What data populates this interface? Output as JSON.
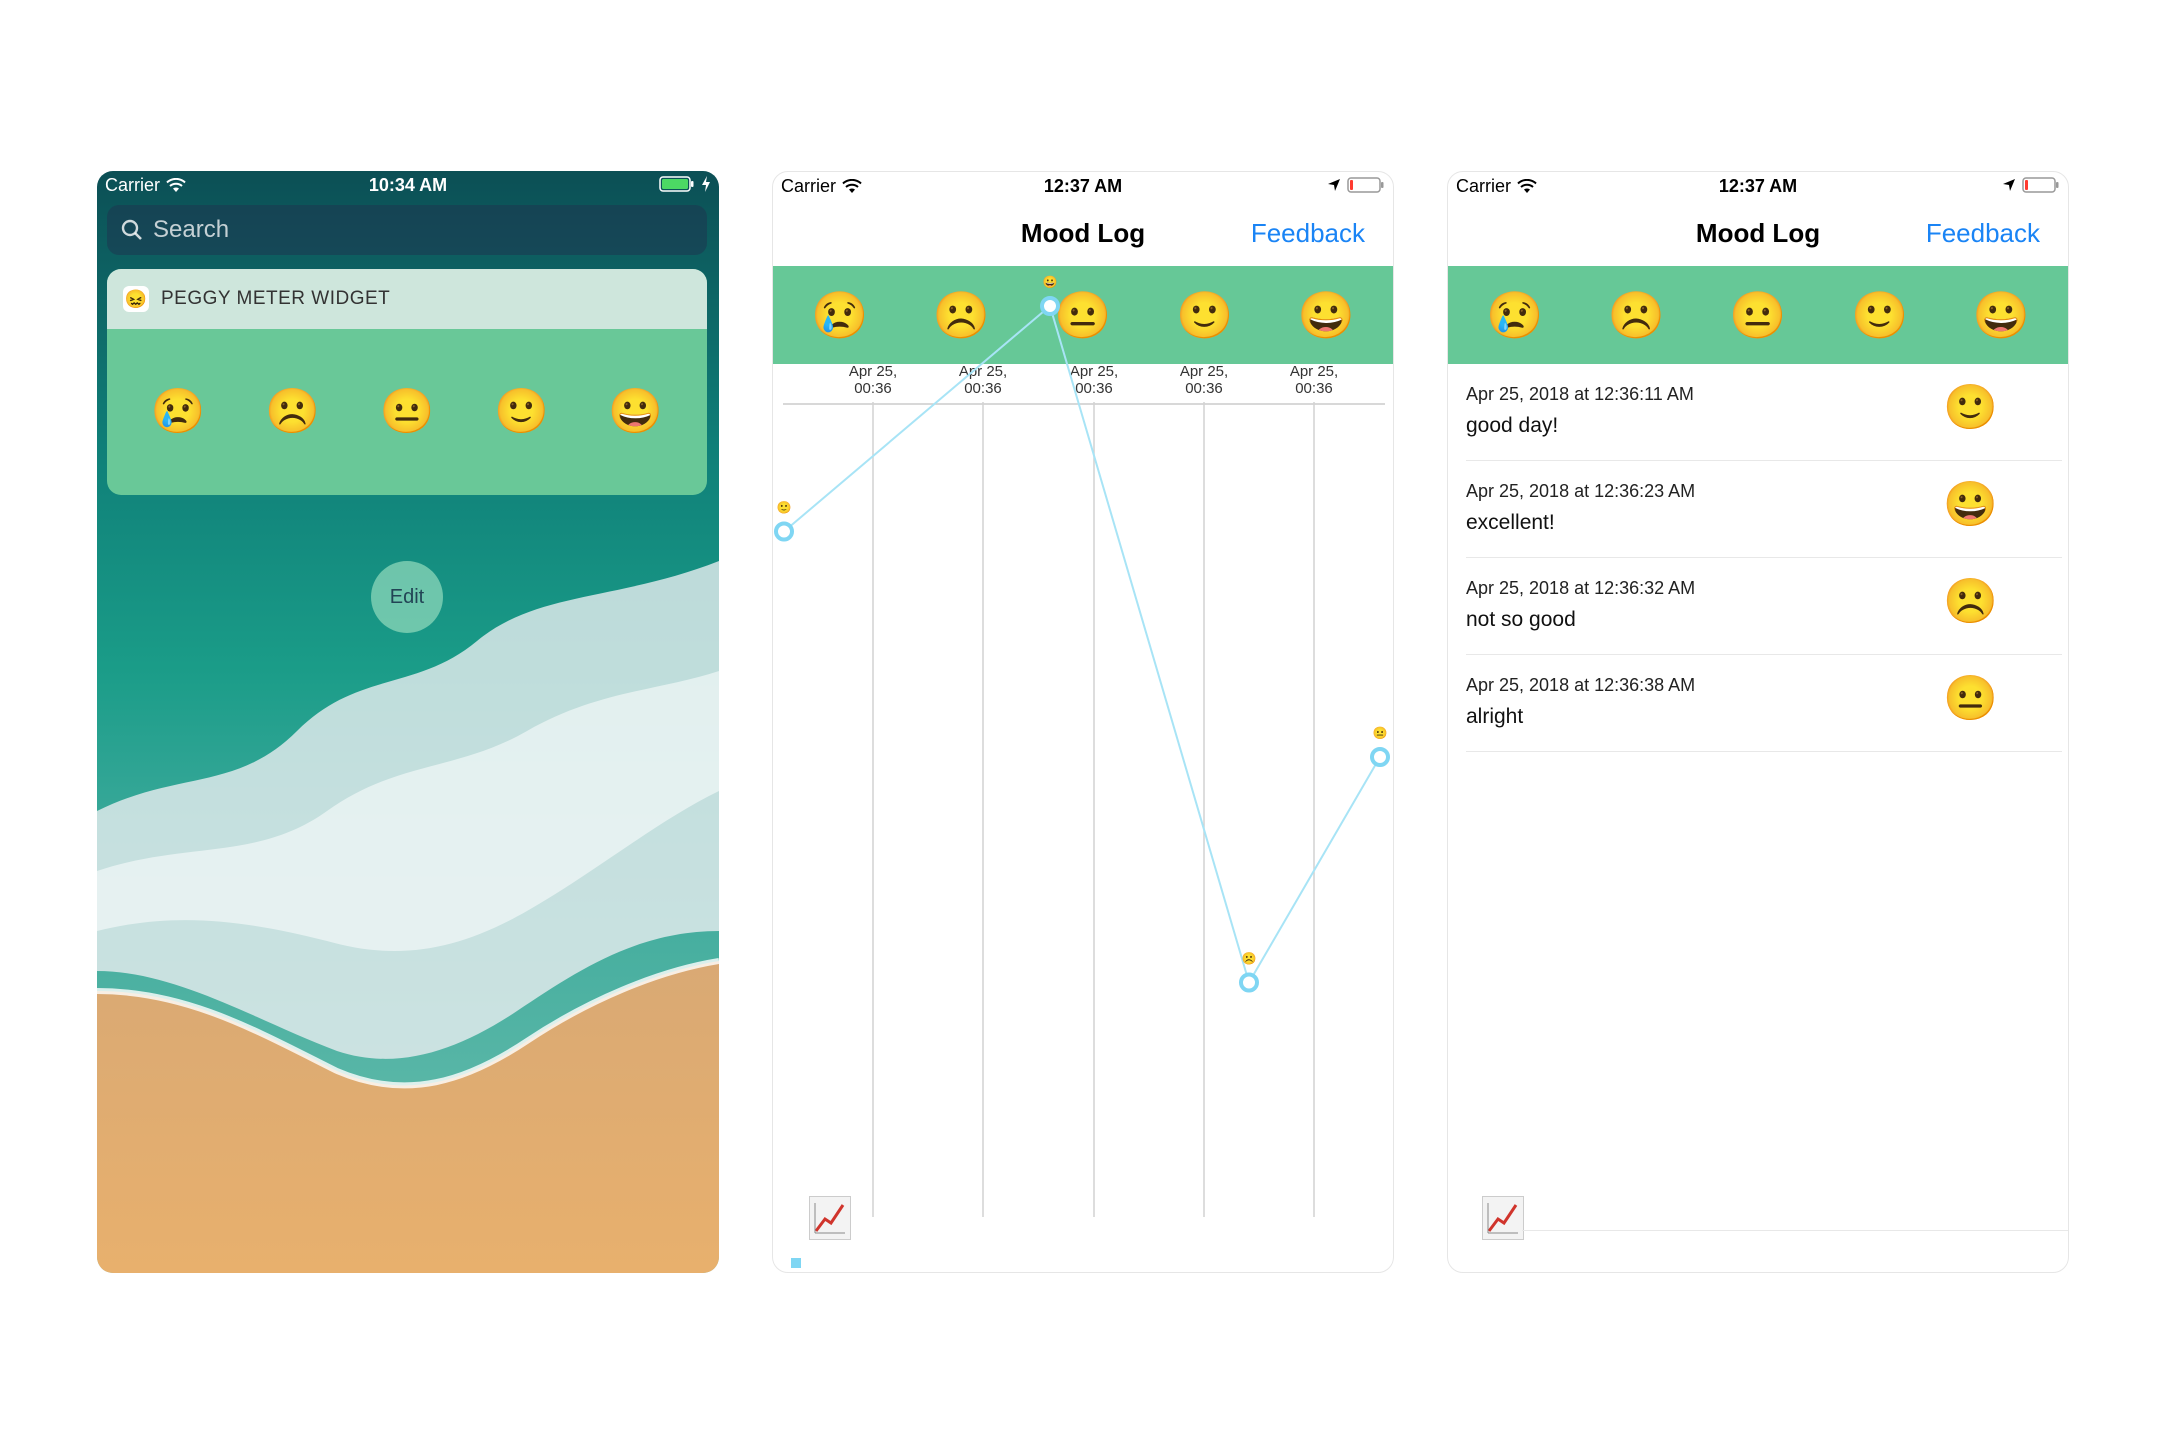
{
  "phone1": {
    "status": {
      "carrier": "Carrier",
      "time": "10:34 AM"
    },
    "search_placeholder": "Search",
    "widget": {
      "title": "PEGGY METER WIDGET",
      "moods": [
        "😢",
        "☹️",
        "😐",
        "🙂",
        "😀"
      ]
    },
    "edit_label": "Edit"
  },
  "phone2": {
    "status": {
      "carrier": "Carrier",
      "time": "12:37 AM"
    },
    "nav": {
      "title": "Mood Log",
      "feedback": "Feedback"
    },
    "moods": [
      "😢",
      "☹️",
      "😐",
      "🙂",
      "😀"
    ],
    "chart_data": {
      "type": "line",
      "x_tick_labels": [
        "Apr 25,\n00:36",
        "Apr 25,\n00:36",
        "Apr 25,\n00:36",
        "Apr 25,\n00:36",
        "Apr 25,\n00:36"
      ],
      "points": [
        {
          "time": "Apr 25, 2018 at 12:36:11 AM",
          "mood": 4,
          "emoji": "🙂"
        },
        {
          "time": "Apr 25, 2018 at 12:36:23 AM",
          "mood": 5,
          "emoji": "😀"
        },
        {
          "time": "Apr 25, 2018 at 12:36:32 AM",
          "mood": 2,
          "emoji": "☹️"
        },
        {
          "time": "Apr 25, 2018 at 12:36:38 AM",
          "mood": 3,
          "emoji": "😐"
        }
      ],
      "grid": true,
      "line_color": "#a8e4f6",
      "marker_color": "#7fd6f3"
    }
  },
  "phone3": {
    "status": {
      "carrier": "Carrier",
      "time": "12:37 AM"
    },
    "nav": {
      "title": "Mood Log",
      "feedback": "Feedback"
    },
    "moods": [
      "😢",
      "☹️",
      "😐",
      "🙂",
      "😀"
    ],
    "log": [
      {
        "date": "Apr 25, 2018 at 12:36:11 AM",
        "note": "good day!",
        "emoji": "🙂"
      },
      {
        "date": "Apr 25, 2018 at 12:36:23 AM",
        "note": "excellent!",
        "emoji": "😀"
      },
      {
        "date": "Apr 25, 2018 at 12:36:32 AM",
        "note": "not so good",
        "emoji": "☹️"
      },
      {
        "date": "Apr 25, 2018 at 12:36:38 AM",
        "note": "alright",
        "emoji": "😐"
      }
    ]
  }
}
